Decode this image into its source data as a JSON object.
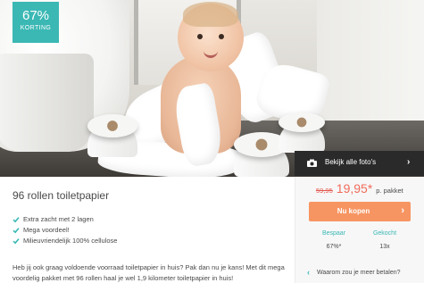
{
  "badge": {
    "percent": "67%",
    "label": "KORTING"
  },
  "photos": {
    "label": "Bekijk alle foto's",
    "icon": "camera-icon"
  },
  "product": {
    "title": "96 rollen toiletpapier",
    "features": [
      "Extra zacht met 2 lagen",
      "Mega voordeel!",
      "Milieuvriendelijk 100% cellulose"
    ],
    "description": "Heb jij ook graag voldoende voorraad toiletpapier in huis? Pak dan nu je kans! Met dit mega voordelig pakket met 96 rollen haal je wel 1,9 kilometer toiletpapier in huis!"
  },
  "pricing": {
    "old_price": "59,95",
    "new_price": "19,95*",
    "unit": "p. pakket",
    "buy_label": "Nu kopen"
  },
  "stats": {
    "savings_label": "Bespaar",
    "savings_value": "67%*",
    "bought_label": "Gekocht",
    "bought_value": "13x"
  },
  "why_link": "Waarom zou je meer betalen?",
  "colors": {
    "teal": "#3bb8b4",
    "orange": "#f79562",
    "price_red": "#f06c5a",
    "dark_bar": "#2a2a2a"
  }
}
